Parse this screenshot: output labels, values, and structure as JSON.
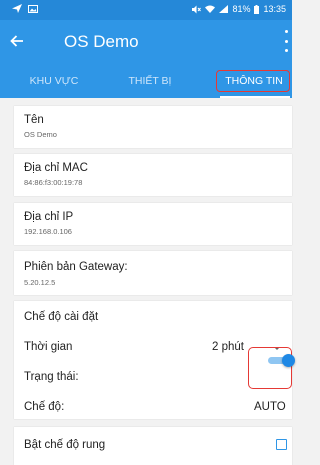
{
  "colors": {
    "accent": "#2f96e6",
    "highlight": "#e53935"
  },
  "status_bar": {
    "signal_text": "81%",
    "time": "13:35"
  },
  "app_bar": {
    "back_icon": "arrow-left-icon",
    "title": "OS Demo",
    "overflow_icon": "more-vert-icon"
  },
  "tabs": [
    {
      "label": "KHU VỰC",
      "selected": false
    },
    {
      "label": "THIẾT BỊ",
      "selected": false
    },
    {
      "label": "THÔNG TIN",
      "selected": true
    }
  ],
  "info": {
    "name": {
      "label": "Tên",
      "value": "OS Demo"
    },
    "mac": {
      "label": "Địa chỉ MAC",
      "value": "84:86:f3:00:19:78"
    },
    "ip": {
      "label": "Địa chỉ IP",
      "value": "192.168.0.106"
    },
    "gateway": {
      "label": "Phiên bản Gateway:",
      "value": "5.20.12.5"
    }
  },
  "settings": {
    "section_title": "Chế độ cài đặt",
    "time_label": "Thời gian",
    "time_value": "2 phút",
    "status_label": "Trạng thái:",
    "status_on": true,
    "mode_label": "Chế độ:",
    "mode_value": "AUTO"
  },
  "vibrate": {
    "label": "Bật chế độ rung",
    "checked": false
  }
}
